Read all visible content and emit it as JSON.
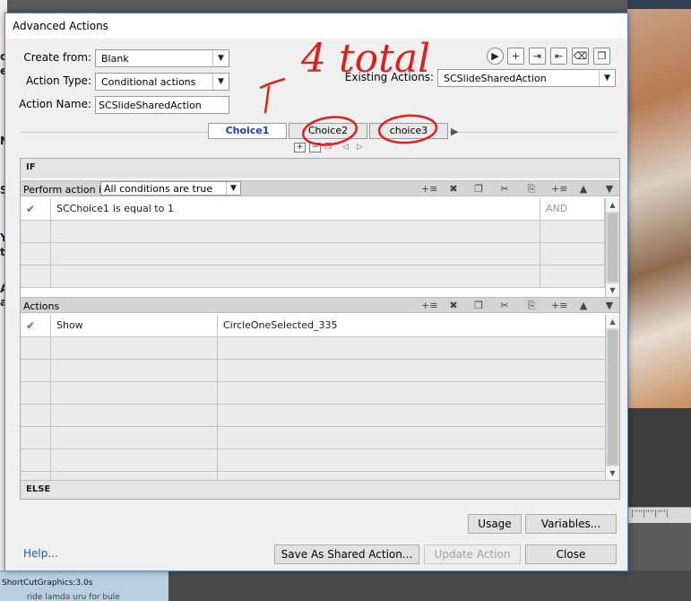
{
  "background": {
    "side_letters": [
      "c",
      "e",
      "N",
      "S",
      "Y",
      "t",
      "A",
      "a"
    ],
    "status_bar": "ShortCutGraphics:3.0s",
    "status_sub": "ride lamda uru for bule",
    "ruler": "|''''|''''|''''|"
  },
  "dialog": {
    "title": "Advanced Actions",
    "create_from": {
      "label": "Create from:",
      "value": "Blank"
    },
    "action_type": {
      "label": "Action Type:",
      "value": "Conditional actions"
    },
    "action_name": {
      "label": "Action Name:",
      "value": "SCSlideSharedAction"
    },
    "existing_actions": {
      "label": "Existing Actions:",
      "value": "SCSlideSharedAction"
    },
    "toolbar": {
      "preview": "▶",
      "add": "+",
      "import": "⇥",
      "export": "⇤",
      "delete": "⌫",
      "duplicate": "❐"
    },
    "tabs": [
      "Choice1",
      "Choice2",
      "choice3"
    ],
    "tab_controls": {
      "add": "+",
      "remove": "−",
      "copy": "❐",
      "prev": "◁",
      "next": "▷",
      "more": "▶"
    },
    "if_section": {
      "title": "IF",
      "perform_label": "Perform action if:",
      "condition_mode": "All conditions are true",
      "conditions": [
        {
          "variable": "SCChoice1",
          "operator": "is equal to",
          "value": "1",
          "join": "AND"
        }
      ]
    },
    "actions_section": {
      "title": "Actions",
      "actions": [
        {
          "command": "Show",
          "target": "CircleOneSelected_335"
        }
      ]
    },
    "else_section": {
      "title": "ELSE"
    },
    "grid_icons": {
      "insert": "+≡",
      "delete": "✖",
      "copy": "❐",
      "cut": "✂",
      "paste": "⎘",
      "insert_below": "+≡",
      "up": "▲",
      "down": "▼"
    },
    "buttons": {
      "usage": "Usage",
      "variables": "Variables...",
      "help": "Help...",
      "save_shared": "Save As Shared Action...",
      "update": "Update Action",
      "close": "Close"
    }
  },
  "annotation": {
    "text": "4 total"
  },
  "colors": {
    "annotation": "#e0201c",
    "link": "#1a5bb3",
    "active_tab": "#1a3fb0"
  }
}
